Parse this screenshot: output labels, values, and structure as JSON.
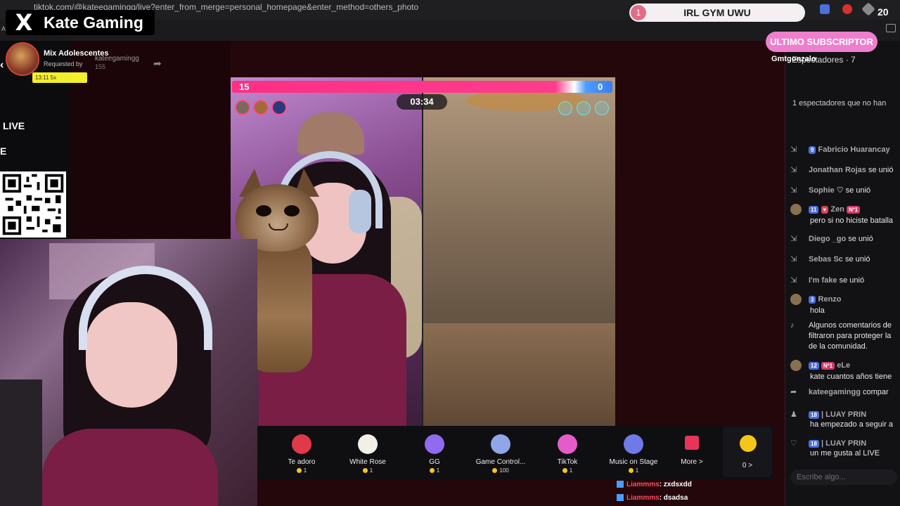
{
  "browser": {
    "url": "tiktok.com/@kateegamingg/live?enter_from_merge=personal_homepage&enter_method=others_photo",
    "bookmark_first": "Ap"
  },
  "brand": {
    "x_logo": "X",
    "name": "Kate Gaming"
  },
  "goal": {
    "number": "1",
    "label": "IRL GYM UWU",
    "count": "20"
  },
  "subscriber": {
    "pill": "ULTIMO SUBSCRIPTOR",
    "name": "Gmtgonzalo"
  },
  "song": {
    "title": "Mix Adolescentes",
    "requested": "Requested by",
    "user": "kateegamingg",
    "count": "155",
    "tag": "13:11  5x"
  },
  "left_labels": {
    "live": "LIVE",
    "e": "E"
  },
  "battle": {
    "score_left": "15",
    "score_right": "0",
    "timer": "03:34"
  },
  "gifts": [
    {
      "name": "Te adoro",
      "price": "1",
      "color": "#e0394a"
    },
    {
      "name": "White Rose",
      "price": "1",
      "color": "#f2f0e6"
    },
    {
      "name": "GG",
      "price": "1",
      "color": "#8f6bf0"
    },
    {
      "name": "Game Control...",
      "price": "100",
      "color": "#8fa6e8"
    },
    {
      "name": "TikTok",
      "price": "1",
      "color": "#e45cc9"
    },
    {
      "name": "Music on Stage",
      "price": "1",
      "color": "#6f7ae8"
    }
  ],
  "gift_more": "More >",
  "coin_label": "0 >",
  "overlay_chat": [
    {
      "user": "Liammms",
      "msg": ": zxdsxdd"
    },
    {
      "user": "Liammms",
      "msg": ": dsadsa"
    }
  ],
  "chat": {
    "header": "Espectadores · 7",
    "note": "1 espectadores que no han",
    "rows": [
      {
        "icon": "join",
        "badge": "9",
        "name": "Fabricio Huarancay",
        "text": ""
      },
      {
        "icon": "join",
        "name": "Jonathan Rojas",
        "text": "se unió"
      },
      {
        "icon": "join",
        "name": "Sophie ♡",
        "text": "se unió"
      },
      {
        "icon": "avatar",
        "badge": "11",
        "heart": "Zen",
        "top": "Nº1",
        "text": "pero si no hiciste batalla"
      },
      {
        "icon": "join",
        "name": "Diego _go",
        "text": "se unió"
      },
      {
        "icon": "join",
        "name": "Sebas Sc",
        "text": "se unió"
      },
      {
        "icon": "join",
        "name": "I'm fake",
        "text": "se unió"
      },
      {
        "icon": "avatar",
        "badge": "3",
        "name": "Renzo",
        "text": "hola"
      },
      {
        "icon": "tiktok",
        "text": "Algunos comentarios de"
      },
      {
        "icon": "",
        "text": "filtraron para proteger la"
      },
      {
        "icon": "",
        "text": "de la comunidad."
      },
      {
        "icon": "avatar",
        "badge": "12",
        "name": "eLe",
        "top": "Nº1",
        "text": "kate cuantos años tiene"
      },
      {
        "icon": "share",
        "name": "kateegamingg",
        "text": "compar"
      },
      {
        "icon": "follow",
        "badge": "18",
        "name": "| LUAY PRIN",
        "text": "ha empezado a seguir a"
      },
      {
        "icon": "heart",
        "badge": "18",
        "name": "| LUAY PRIN",
        "text": "un me gusta al LIVE"
      }
    ],
    "input_placeholder": "Escribe algo..."
  }
}
